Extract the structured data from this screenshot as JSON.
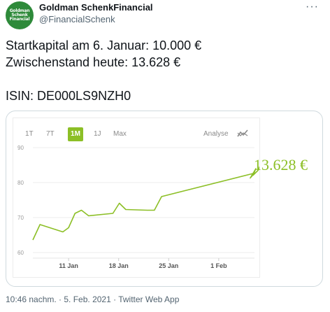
{
  "author": {
    "avatar_lines": [
      "Goldman",
      "Schenk",
      "Financial"
    ],
    "name": "Goldman SchenkFinancial",
    "handle": "@FinancialSchenk"
  },
  "tweet": {
    "line1": "Startkapital am 6. Januar: 10.000 €",
    "line2": "Zwischenstand heute: 13.628 €",
    "line3": "ISIN: DE000LS9NZH0"
  },
  "chart_tabs": [
    {
      "label": "1T",
      "active": false
    },
    {
      "label": "7T",
      "active": false
    },
    {
      "label": "1M",
      "active": true
    },
    {
      "label": "1J",
      "active": false
    },
    {
      "label": "Max",
      "active": false
    }
  ],
  "analyse_label": "Analyse",
  "last_value_label": "13.628 €",
  "timestamp": "10:46 nachm. · 5. Feb. 2021 · Twitter Web App",
  "colors": {
    "accent": "#8cbf26",
    "text": "#0f1419",
    "muted": "#536471",
    "border": "#cfd9de"
  },
  "icons": {
    "more": "more-icon",
    "analyse": "analyse-icon"
  },
  "chart_data": {
    "type": "line",
    "title": "",
    "xlabel": "",
    "ylabel": "",
    "y_ticks": [
      60,
      70,
      80,
      90
    ],
    "ylim": [
      60,
      90
    ],
    "x_ticks": [
      {
        "label": "11 Jan",
        "day": 11
      },
      {
        "label": "18 Jan",
        "day": 18
      },
      {
        "label": "25 Jan",
        "day": 25
      },
      {
        "label": "1 Feb",
        "day": 32
      }
    ],
    "xlim": [
      6,
      37
    ],
    "grid": true,
    "series": [
      {
        "x": [
          6.0,
          7.0,
          10.2,
          11.0,
          11.9,
          12.8,
          13.8,
          17.2,
          18.1,
          19.0,
          22.0,
          23.0,
          24.0,
          37.0,
          36.4,
          37.2,
          36.8,
          37.5,
          38.0,
          37.6,
          37.9
        ],
        "y": [
          63.6,
          68.0,
          65.9,
          67.1,
          71.2,
          72.1,
          70.5,
          71.2,
          74.1,
          72.3,
          72.1,
          72.1,
          76.0,
          82.7,
          81.3,
          84.0,
          82.1,
          83.5,
          85.8,
          83.8,
          85.5
        ]
      }
    ]
  }
}
